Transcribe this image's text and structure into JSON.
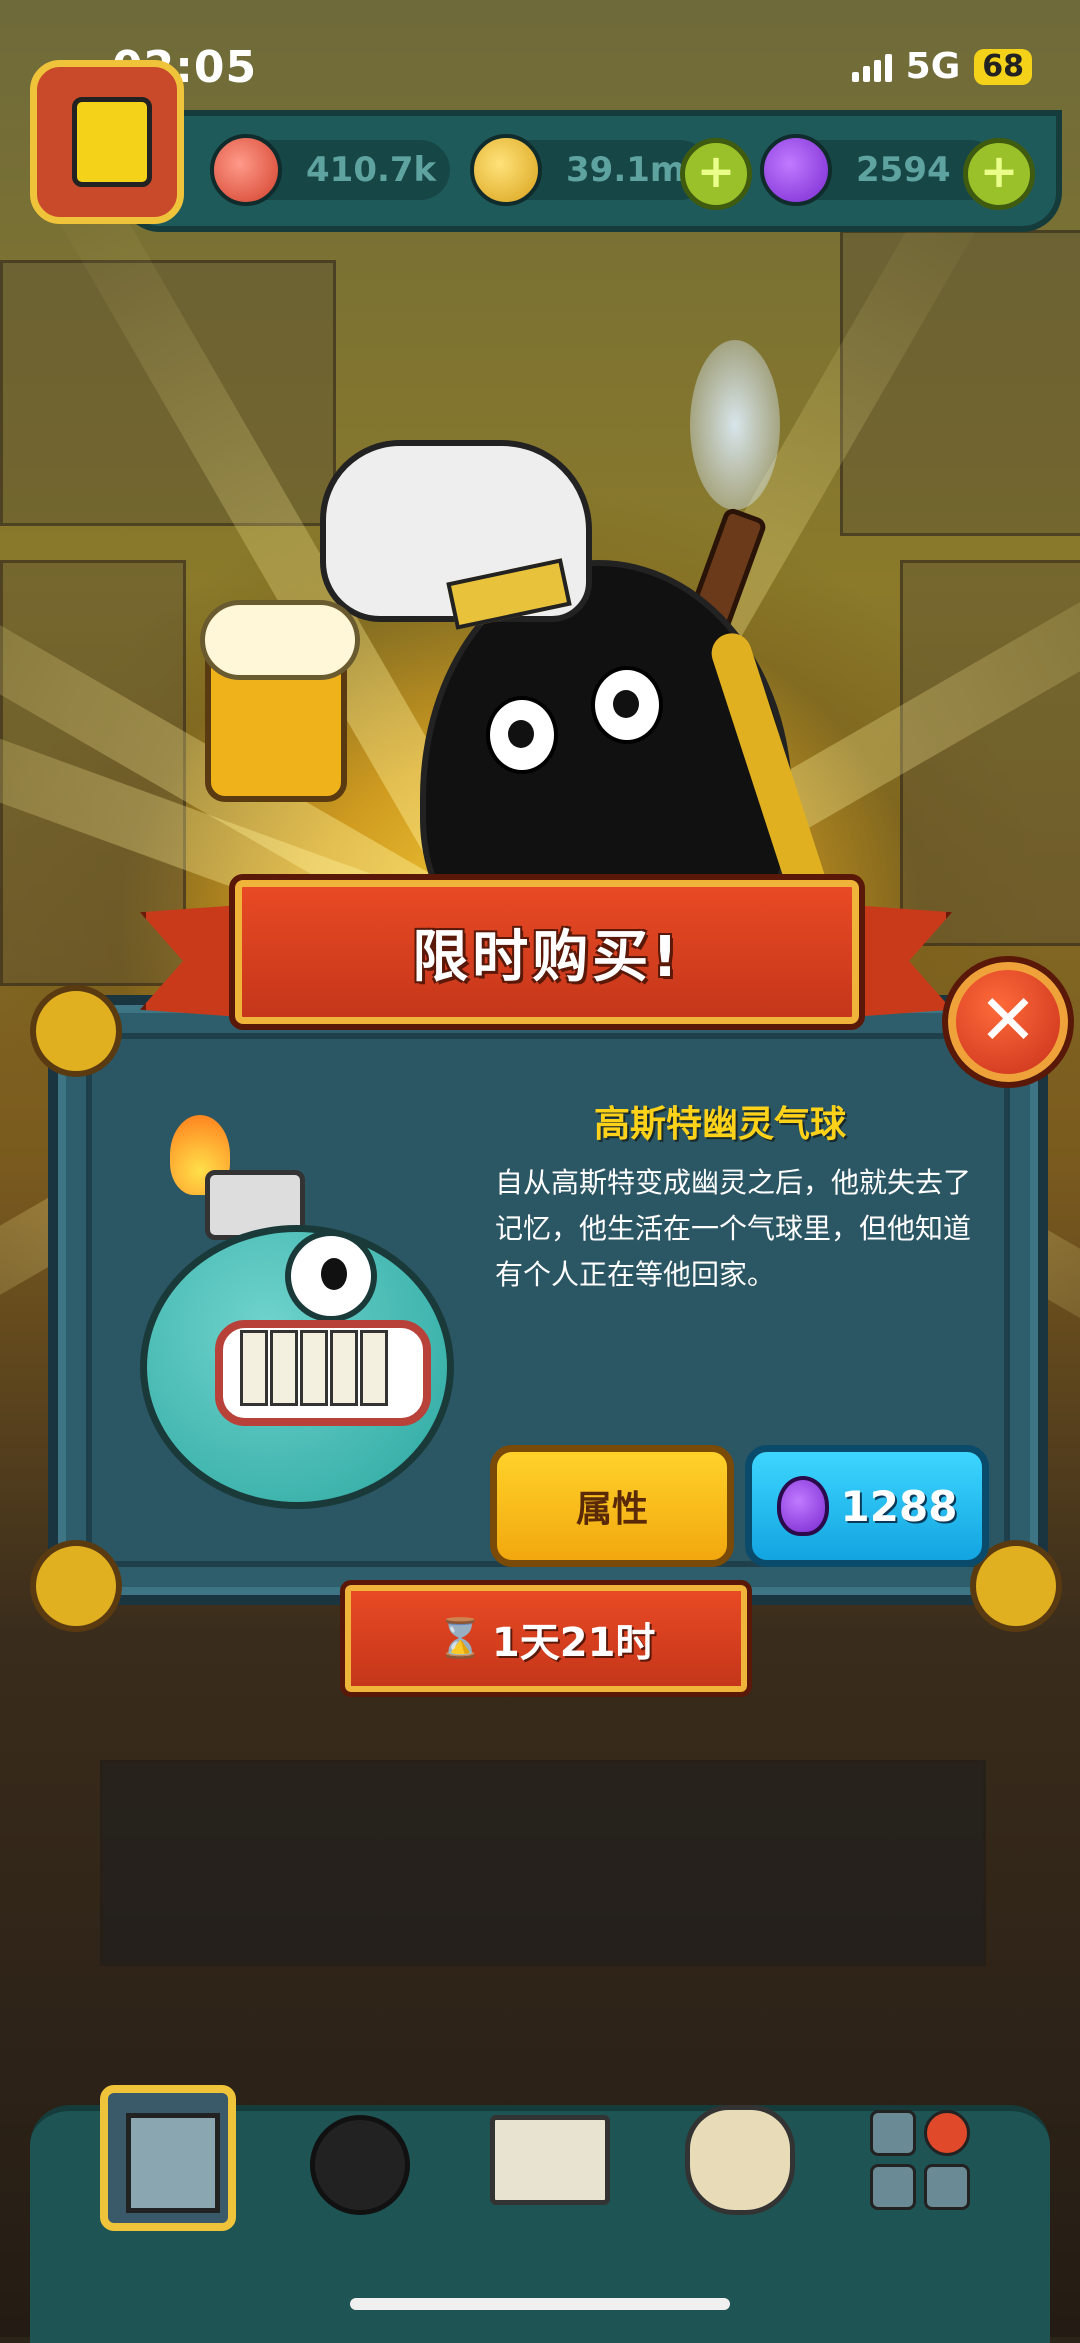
{
  "status_bar": {
    "time": "02:05",
    "network": "5G",
    "battery": "68"
  },
  "hud": {
    "resources": [
      {
        "icon": "eyeball-icon",
        "value": "410.7k"
      },
      {
        "icon": "gold-coin-icon",
        "value": "39.1m",
        "has_plus": true
      },
      {
        "icon": "purple-potion-icon",
        "value": "2594",
        "has_plus": true
      }
    ]
  },
  "offer": {
    "banner_title": "限时购买!",
    "item_name": "高斯特幽灵气球",
    "item_description": "自从高斯特变成幽灵之后，他就失去了记忆，他生活在一个气球里，但他知道有个人正在等他回家。",
    "attributes_button": "属性",
    "price": "1288",
    "price_icon": "purple-potion-icon",
    "timer": "1天21时",
    "timer_icon": "hourglass-icon",
    "close_icon": "close-icon"
  },
  "bottom_nav": {
    "items": [
      {
        "icon": "building-icon",
        "active": true
      },
      {
        "icon": "monster-icon"
      },
      {
        "icon": "book-icon"
      },
      {
        "icon": "coin-bag-icon"
      },
      {
        "icon": "more-grid-icon"
      }
    ]
  },
  "colors": {
    "panel": "#2e5d6b",
    "ribbon": "#c93a1a",
    "gold_title": "#ffd21a",
    "attr_button": "#ffd22a",
    "buy_button": "#12a4e0"
  }
}
